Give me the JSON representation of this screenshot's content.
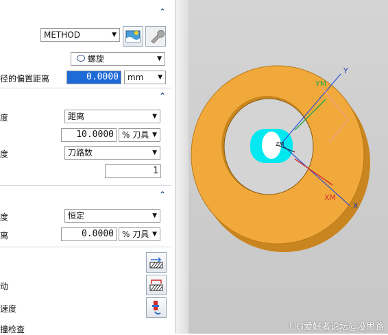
{
  "panel": {
    "method_select": "METHOD",
    "pattern_select": "螺旋",
    "offset_label": "径的偏置距离",
    "offset_value": "0.0000",
    "offset_unit": "mm",
    "section2": {
      "row1_label": "度",
      "row1_select": "距离",
      "row2_value": "10.0000",
      "row2_unit": "% 刀具",
      "row3_label": "度",
      "row3_select": "刀路数",
      "row4_value": "1"
    },
    "section3": {
      "row1_label": "度",
      "row1_select": "恒定",
      "row2_label": "离",
      "row2_value": "0.0000",
      "row2_unit": "% 刀具"
    },
    "section4": {
      "row1_label": "动",
      "row2_label": "速度",
      "row3_label": "撞检查"
    }
  },
  "viewport": {
    "axis_y": "Y",
    "axis_ym": "YM",
    "axis_xm": "XM",
    "axis_x": "X",
    "axis_z": "ZM",
    "watermark": "UG爱好者论坛@没思路",
    "colors": {
      "part": "#f2a93b",
      "tool": "#00e8f0",
      "background": "#cfcfcf"
    }
  }
}
